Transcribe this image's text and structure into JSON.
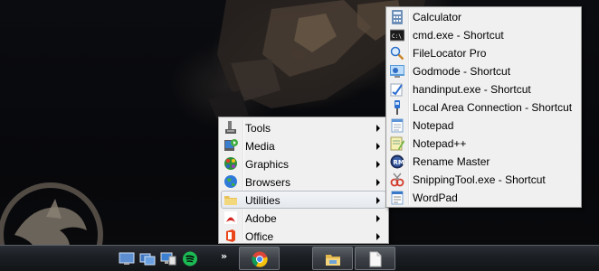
{
  "main_menu": {
    "items": [
      {
        "label": "Tools",
        "icon": "tools-icon",
        "has_submenu": true
      },
      {
        "label": "Media",
        "icon": "media-icon",
        "has_submenu": true
      },
      {
        "label": "Graphics",
        "icon": "graphics-icon",
        "has_submenu": true
      },
      {
        "label": "Browsers",
        "icon": "globe-icon",
        "has_submenu": true
      },
      {
        "label": "Utilities",
        "icon": "utilities-folder-icon",
        "has_submenu": true,
        "active": true
      },
      {
        "label": "Adobe",
        "icon": "adobe-icon",
        "has_submenu": true
      },
      {
        "label": "Office",
        "icon": "office-icon",
        "has_submenu": true
      }
    ]
  },
  "utilities_submenu": {
    "items": [
      {
        "label": "Calculator",
        "icon": "calculator-icon"
      },
      {
        "label": "cmd.exe - Shortcut",
        "icon": "command-prompt-icon"
      },
      {
        "label": "FileLocator Pro",
        "icon": "magnifier-icon"
      },
      {
        "label": "Godmode - Shortcut",
        "icon": "control-panel-icon"
      },
      {
        "label": "handinput.exe - Shortcut",
        "icon": "handwriting-icon"
      },
      {
        "label": "Local Area Connection - Shortcut",
        "icon": "network-cable-icon"
      },
      {
        "label": "Notepad",
        "icon": "notepad-icon"
      },
      {
        "label": "Notepad++",
        "icon": "notepad-plus-plus-icon"
      },
      {
        "label": "Rename Master",
        "icon": "rename-master-icon"
      },
      {
        "label": "SnippingTool.exe - Shortcut",
        "icon": "snipping-tool-icon"
      },
      {
        "label": "WordPad",
        "icon": "wordpad-icon"
      }
    ]
  },
  "taskbar": {
    "toolbar_chevron": "»",
    "quick_launch": [
      "show-desktop-icon",
      "window-switcher-icon",
      "remote-desktop-icon",
      "spotify-icon"
    ],
    "buttons": [
      "chrome-icon",
      "file-explorer-icon",
      "blank-document-icon"
    ]
  },
  "colors": {
    "menu_bg": "#f0f0f0",
    "menu_border": "#979797",
    "highlight_border": "#b8bcc3",
    "taskbar_top": "#2b2f36",
    "adobe_red": "#d4261f",
    "office_orange": "#e9461c",
    "spotify_green": "#1db954"
  }
}
